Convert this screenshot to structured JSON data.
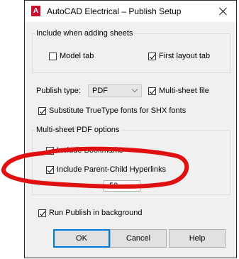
{
  "window": {
    "title": "AutoCAD Electrical – Publish Setup",
    "app_icon_letter": "A"
  },
  "include_group": {
    "legend": "Include when adding sheets",
    "model_tab": {
      "label": "Model tab",
      "checked": false
    },
    "first_layout_tab": {
      "label": "First layout tab",
      "checked": true
    }
  },
  "publish_type": {
    "label": "Publish type:",
    "value": "PDF"
  },
  "multi_sheet_file": {
    "label": "Multi-sheet file",
    "checked": true
  },
  "substitute_fonts": {
    "label": "Substitute TrueType fonts for SHX fonts",
    "checked": true
  },
  "pdf_group": {
    "legend": "Multi-sheet PDF options",
    "include_bookmarks": {
      "label": "Include Bookmarks",
      "checked": true
    },
    "include_hyperlinks": {
      "label": "Include Parent-Child Hyperlinks",
      "checked": true
    },
    "spinner_value": "50"
  },
  "run_background": {
    "label": "Run Publish in background",
    "checked": true
  },
  "buttons": {
    "ok": "OK",
    "cancel": "Cancel",
    "help": "Help"
  },
  "annotation": {
    "color": "#e01010"
  }
}
